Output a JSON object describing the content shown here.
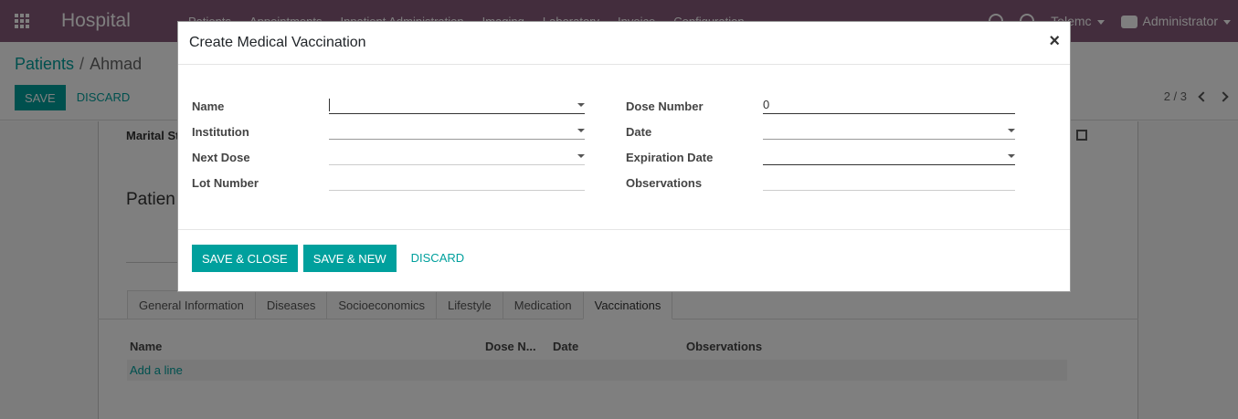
{
  "navbar": {
    "brand": "Hospital",
    "menu": [
      "Patients",
      "Appointments",
      "Inpatient Administration",
      "Imaging",
      "Laboratory",
      "Invoice",
      "Configuration"
    ],
    "company": "Telemc",
    "user": "Administrator",
    "colors": {
      "background": "#875A7B"
    }
  },
  "breadcrumb": {
    "parent": "Patients",
    "current": "Ahmad"
  },
  "control": {
    "save": "SAVE",
    "discard": "DISCARD",
    "pager": "2 / 3"
  },
  "sheet": {
    "marital_label": "Marital St",
    "patient_label": "Patien",
    "tabs": [
      "General Information",
      "Diseases",
      "Socioeconomics",
      "Lifestyle",
      "Medication",
      "Vaccinations"
    ],
    "active_tab": "Vaccinations",
    "list_headers": [
      "Name",
      "Dose N...",
      "Date",
      "Observations"
    ],
    "add_line": "Add a line"
  },
  "modal": {
    "title": "Create Medical Vaccination",
    "close": "×",
    "fields": {
      "name": {
        "label": "Name",
        "value": ""
      },
      "institution": {
        "label": "Institution",
        "value": ""
      },
      "next_dose": {
        "label": "Next Dose",
        "value": ""
      },
      "lot_number": {
        "label": "Lot Number",
        "value": ""
      },
      "dose_number": {
        "label": "Dose Number",
        "value": "0"
      },
      "date": {
        "label": "Date",
        "value": ""
      },
      "expiration_date": {
        "label": "Expiration Date",
        "value": ""
      },
      "observations": {
        "label": "Observations",
        "value": ""
      }
    },
    "footer": {
      "save_close": "SAVE & CLOSE",
      "save_new": "SAVE & NEW",
      "discard": "DISCARD"
    }
  },
  "colors": {
    "accent": "#00A09D",
    "overlay": "rgba(0,0,0,0.5)"
  }
}
